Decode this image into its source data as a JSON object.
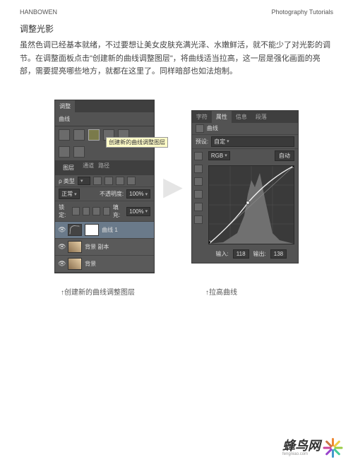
{
  "header": {
    "left": "HANBOWEN",
    "right": "Photography Tutorials"
  },
  "section": {
    "title": "调整光影",
    "body": "虽然色调已经基本就绪，不过要想让美女皮肤充满光泽、水嫩鲜活，就不能少了对光影的调节。在调整面板点击\"创建新的曲线调整图层\"，将曲线适当拉高，这一层是强化画面的亮部，需要提亮哪些地方，就都在这里了。同样暗部也如法炮制。"
  },
  "left_panel": {
    "tab_adjust": "调整",
    "sub_curve": "曲线",
    "tooltip": "创建新的曲线调整图层",
    "layers_tabs": [
      "图层",
      "通道",
      "路径"
    ],
    "type_label": "ρ 类型",
    "mode": "正常",
    "opacity_label": "不透明度:",
    "opacity_value": "100%",
    "lock_label": "锁定:",
    "fill_label": "填充:",
    "fill_value": "100%",
    "layers": [
      {
        "name": "曲线 1"
      },
      {
        "name": "背景 副本"
      },
      {
        "name": "背景"
      }
    ]
  },
  "right_panel": {
    "tabs": [
      "字符",
      "属性",
      "信息",
      "段落"
    ],
    "sub_curve": "曲线",
    "preset_label": "预设:",
    "preset_value": "自定",
    "channel": "RGB",
    "auto": "自动",
    "input_label": "输入:",
    "input_value": "118",
    "output_label": "输出:",
    "output_value": "138"
  },
  "captions": {
    "left": "↑创建新的曲线调整图层",
    "right": "↑拉高曲线"
  },
  "logo": {
    "text": "蜂鸟网",
    "sub": "fengniao.com"
  },
  "chart_data": {
    "type": "line",
    "title": "曲线",
    "xlabel": "输入",
    "ylabel": "输出",
    "xlim": [
      0,
      255
    ],
    "ylim": [
      0,
      255
    ],
    "series": [
      {
        "name": "曲线",
        "x": [
          0,
          60,
          118,
          200,
          255
        ],
        "y": [
          0,
          75,
          138,
          215,
          255
        ]
      }
    ],
    "selected_point": {
      "input": 118,
      "output": 138
    },
    "histogram_peak_range": [
      100,
      170
    ]
  }
}
